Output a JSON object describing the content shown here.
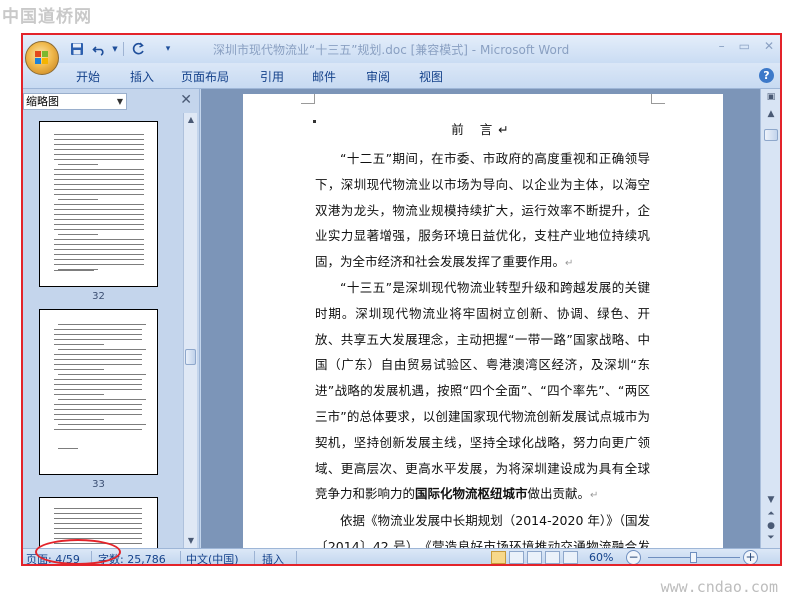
{
  "watermark": {
    "site_logo": "中国道桥网",
    "site_url": "www.cndao.com"
  },
  "window": {
    "title": "深圳市现代物流业“十三五”规划.doc [兼容模式] - Microsoft Word",
    "controls": {
      "minimize": "–",
      "restore": "▭",
      "close": "✕"
    }
  },
  "quick_access": {
    "save": "save-icon",
    "undo": "undo-icon",
    "redo": "redo-icon",
    "customize": "customize-icon"
  },
  "ribbon": {
    "tabs": [
      "开始",
      "插入",
      "页面布局",
      "引用",
      "邮件",
      "审阅",
      "视图"
    ],
    "help": "?"
  },
  "pane": {
    "mode_label": "缩略图",
    "thumbnails": [
      {
        "page": "32"
      },
      {
        "page": "33"
      },
      {
        "page": ""
      }
    ]
  },
  "document": {
    "heading": "前 言",
    "paragraphs": [
      "“十二五”期间，在市委、市政府的高度重视和正确领导下，深圳现代物流业以市场为导向、以企业为主体，以海空双港为龙头，物流业规模持续扩大，运行效率不断提升，企业实力显著增强，服务环境日益优化，支柱产业地位持续巩固，为全市经济和社会发展发挥了重要作用。",
      "“十三五”是深圳现代物流业转型升级和跨越发展的关键时期。深圳现代物流业将牢固树立创新、协调、绿色、开放、共享五大发展理念，主动把握“一带一路”国家战略、中国（广东）自由贸易试验区、粤港澳湾区经济，及深圳“东进”战略的发展机遇，按照“四个全面”、“四个率先”、“两区三市”的总体要求，以创建国家现代物流创新发展试点城市为契机，坚持创新发展主线，坚持全球化战略，努力向更广领域、更高层次、更高水平发展，为将深圳建设成为具有全球竞争力和影响力的",
      "国际化物流枢纽城市",
      "做出贡献。",
      "依据《物流业发展中长期规划（2014-2020 年）》（国发〔2014〕42 号）、《营造良好市场环境推动交通物流融合发展"
    ],
    "mark": "↵"
  },
  "statusbar": {
    "page": "页面: 4/59",
    "words": "字数: 25,786",
    "language": "中文(中国)",
    "mode": "插入",
    "zoom": "60%",
    "zoom_fraction": 0.5
  }
}
